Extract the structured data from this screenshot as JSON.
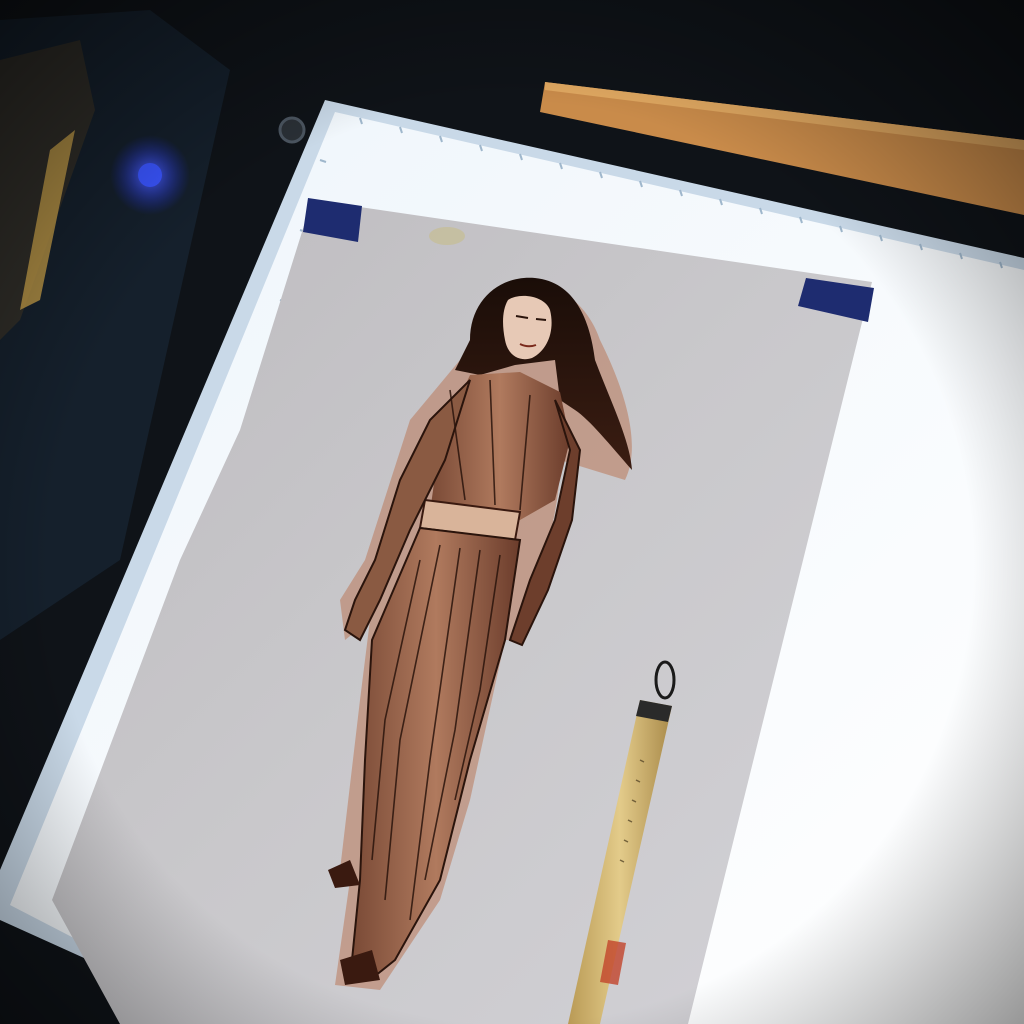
{
  "scene": {
    "subject": "ink-drawing-on-lightbox",
    "colors": {
      "desk": "#0d1014",
      "lightbox_frame": "#d7e6f2",
      "lightbox_glow": "#f4f8fc",
      "paper": "#c7c6c9",
      "tape": "#1f2f77",
      "ink": "#2a140c",
      "sepia_wash": "#b9785a",
      "brush_handle": "#d8bf79",
      "ruler": "#d79b52",
      "led": "#2e4cff"
    },
    "objects": [
      {
        "name": "lightbox",
        "icon": "lightbox-panel"
      },
      {
        "name": "paper-sheet",
        "icon": "paper-sheet"
      },
      {
        "name": "figure-drawing",
        "icon": "figure-sketch"
      },
      {
        "name": "brush-pen",
        "icon": "brush-pen"
      },
      {
        "name": "ruler",
        "icon": "ruler"
      },
      {
        "name": "masking-tape",
        "icon": "tape"
      }
    ]
  }
}
